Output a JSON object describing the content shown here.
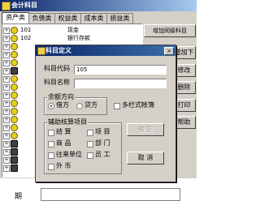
{
  "main_window": {
    "title": "会计科目",
    "tabs": [
      "资产类",
      "负债类",
      "权益类",
      "成本类",
      "损益类"
    ],
    "right_buttons": [
      "增加同级科目",
      "增加下级科目",
      "修改",
      "删除",
      "打印",
      "帮助"
    ],
    "rows": [
      {
        "code": "101",
        "name": "现金"
      },
      {
        "code": "102",
        "name": "银行存款"
      },
      {
        "code": "",
        "name": ""
      },
      {
        "code": "",
        "name": ""
      },
      {
        "code": "",
        "name": ""
      },
      {
        "code": "",
        "name": ""
      },
      {
        "code": "",
        "name": ""
      },
      {
        "code": "",
        "name": ""
      },
      {
        "code": "",
        "name": ""
      },
      {
        "code": "",
        "name": ""
      },
      {
        "code": "",
        "name": ""
      },
      {
        "code": "",
        "name": ""
      },
      {
        "code": "",
        "name": ""
      },
      {
        "code": "",
        "name": ""
      },
      {
        "code": "",
        "name": ""
      },
      {
        "code": "",
        "name": ""
      },
      {
        "code": "",
        "name": ""
      },
      {
        "code": "",
        "name": ""
      }
    ],
    "bottom_label": "期"
  },
  "dialog": {
    "title": "科目定义",
    "close_glyph": "×",
    "code_label": "科目代码",
    "code_value": "105",
    "name_label": "科目名称",
    "name_value": "",
    "balance_group": "余额方向",
    "debit_label": "借方",
    "credit_label": "贷方",
    "multi_column_label": "多栏式帐簿",
    "aux_group": "辅助核算项目",
    "aux_items": [
      "结 算",
      "项 目",
      "商 品",
      "部 门",
      "往来单位",
      "员 工",
      "外 币"
    ],
    "confirm_label": "确 定",
    "cancel_label": "取 消"
  },
  "colors": {
    "title_bar": "#0a246a",
    "face": "#d4d0c8"
  }
}
